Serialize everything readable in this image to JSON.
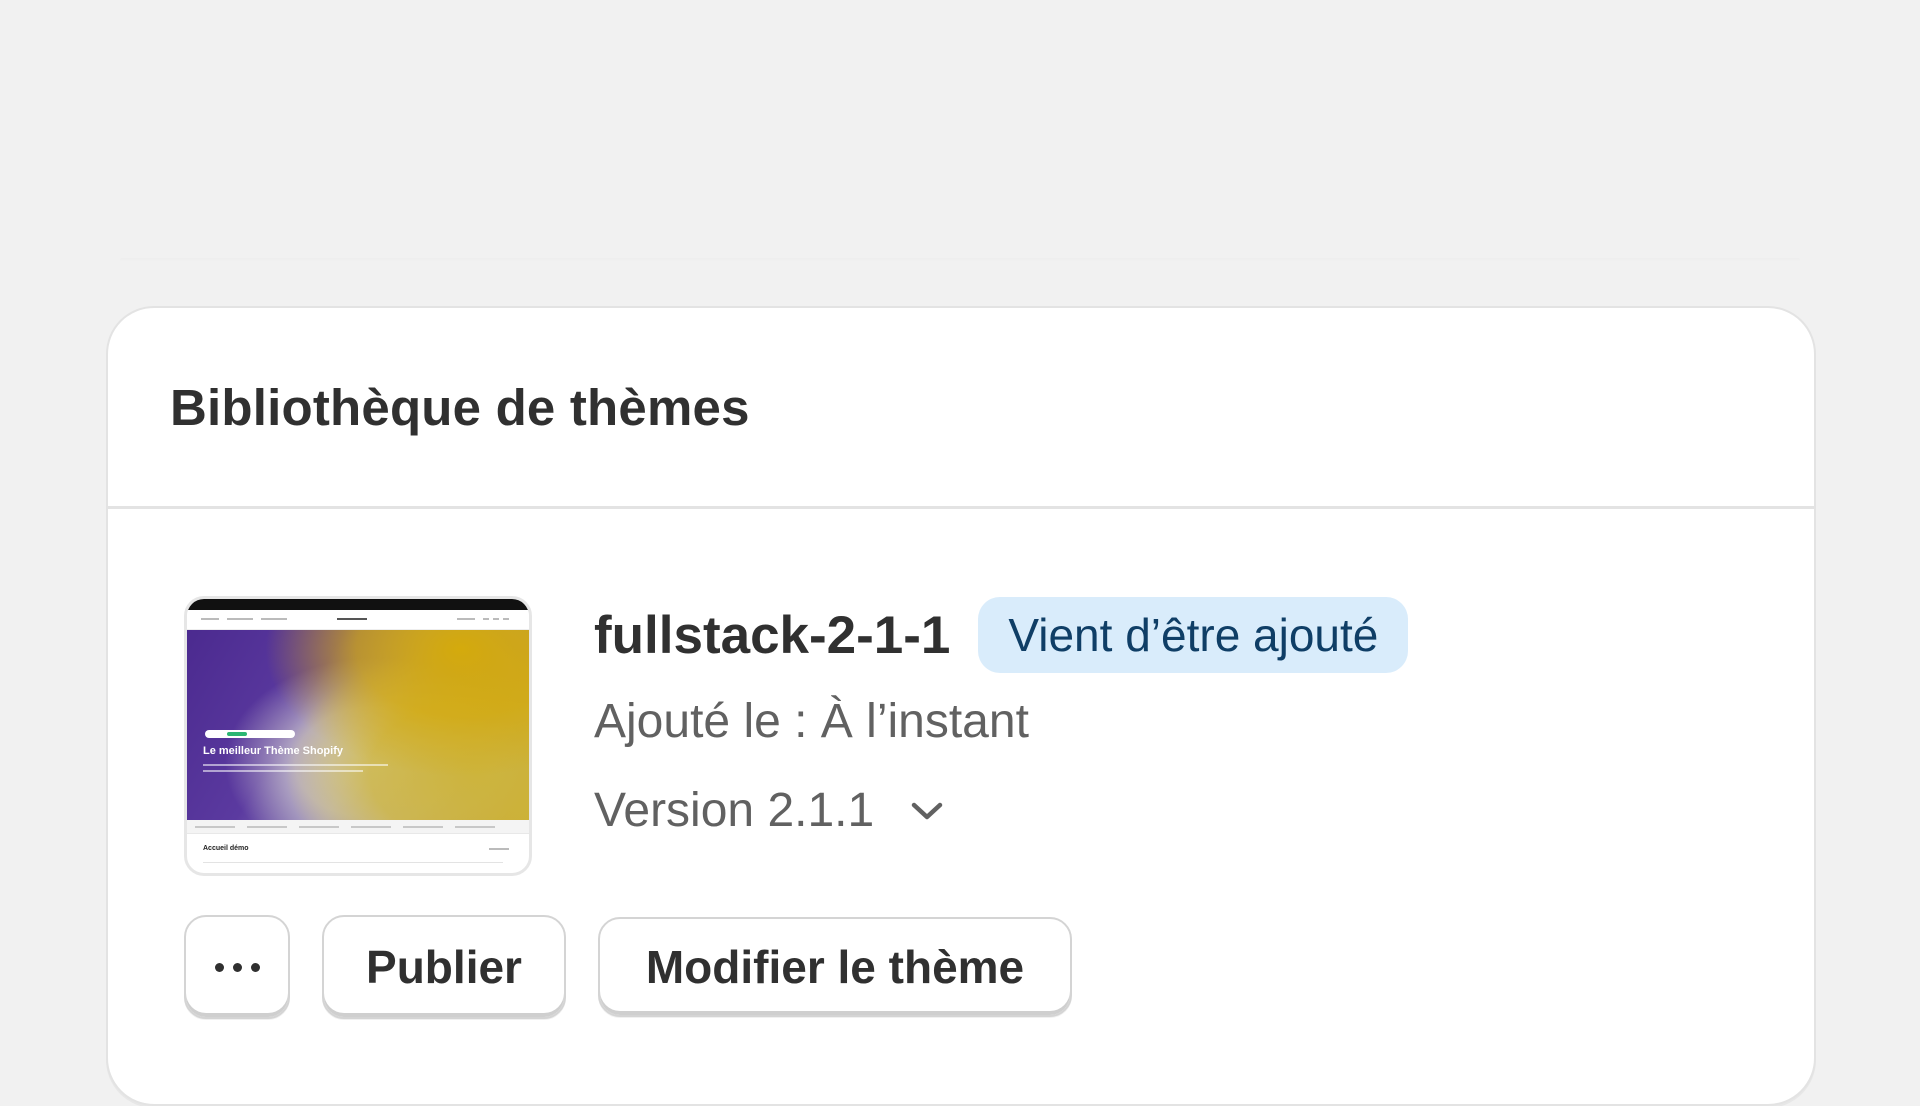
{
  "card": {
    "title": "Bibliothèque de thèmes"
  },
  "theme": {
    "name": "fullstack-2-1-1",
    "badge": "Vient d’être ajouté",
    "added": "Ajouté le : À l’instant",
    "version": "Version 2.1.1",
    "thumbnail": {
      "headline": "Le meilleur Thème Shopify",
      "section_label": "Accueil démo"
    }
  },
  "actions": {
    "publish_label": "Publier",
    "edit_label": "Modifier le thème"
  },
  "icons": {
    "more": "more-horizontal-icon",
    "version_toggle": "chevron-down-icon"
  },
  "colors": {
    "background": "#f1f1f1",
    "card": "#ffffff",
    "badge_bg": "#d9ecfb",
    "badge_text": "#0f3e66",
    "text_primary": "#303030",
    "text_secondary": "#616161"
  }
}
